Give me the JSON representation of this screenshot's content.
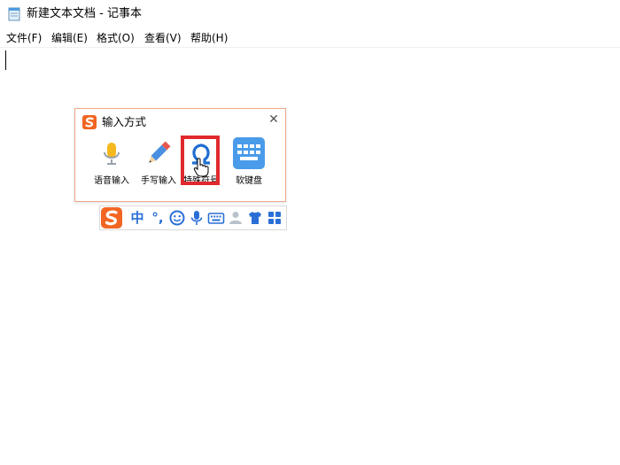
{
  "window": {
    "title": "新建文本文档 - 记事本",
    "menu": [
      "文件(F)",
      "编辑(E)",
      "格式(O)",
      "查看(V)",
      "帮助(H)"
    ]
  },
  "editor": {
    "content": ""
  },
  "ime_panel": {
    "title": "输入方式",
    "tools": [
      {
        "label": "语音输入",
        "icon": "microphone-icon"
      },
      {
        "label": "手写输入",
        "icon": "pencil-icon"
      },
      {
        "label": "特殊符号",
        "icon": "omega-icon",
        "highlighted": true
      },
      {
        "label": "软键盘",
        "icon": "keyboard-icon"
      }
    ]
  },
  "ime_toolbar": {
    "mode_label": "中",
    "punct_label": "°,",
    "items": [
      "sogou-logo",
      "chinese-mode",
      "punctuation",
      "emoji-icon",
      "microphone-icon",
      "keyboard-icon",
      "user-icon",
      "shirt-icon",
      "grid-icon"
    ]
  },
  "colors": {
    "sogou_orange": "#f26522",
    "ime_blue": "#2a6fd6",
    "highlight_red": "#e0292d",
    "keyboard_blue": "#4a9bea"
  }
}
